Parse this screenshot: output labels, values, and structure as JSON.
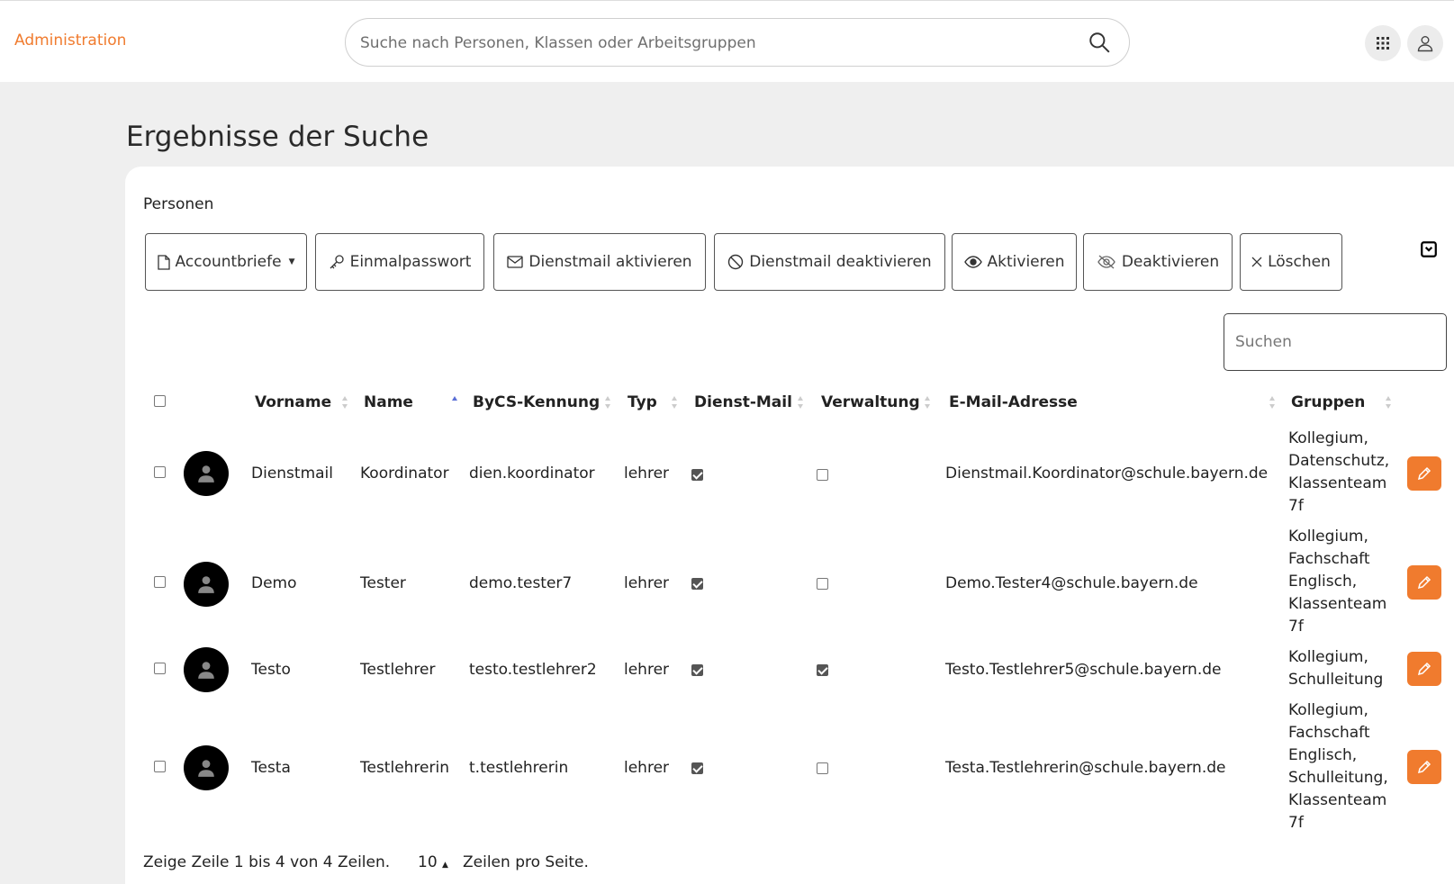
{
  "header": {
    "brand": "Administration",
    "search_placeholder": "Suche nach Personen, Klassen oder Arbeitsgruppen"
  },
  "page_title": "Ergebnisse der Suche",
  "section_label": "Personen",
  "toolbar": {
    "accountbriefe": "Accountbriefe",
    "einmalpasswort": "Einmalpasswort",
    "dienstmail_aktivieren": "Dienstmail aktivieren",
    "dienstmail_deaktivieren": "Dienstmail deaktivieren",
    "aktivieren": "Aktivieren",
    "deaktivieren": "Deaktivieren",
    "loeschen": "Löschen"
  },
  "table_search_placeholder": "Suchen",
  "columns": {
    "vorname": "Vorname",
    "name": "Name",
    "kennung": "ByCS-Kennung",
    "typ": "Typ",
    "dienstmail": "Dienst-Mail",
    "verwaltung": "Verwaltung",
    "email": "E-Mail-Adresse",
    "gruppen": "Gruppen"
  },
  "rows": [
    {
      "vorname": "Dienstmail",
      "name": "Koordinator",
      "kennung": "dien.koordinator",
      "typ": "lehrer",
      "dienstmail": true,
      "verwaltung": false,
      "email": "Dienstmail.Koordinator@schule.bayern.de",
      "gruppen": "Kollegium, Datenschutz, Klassenteam 7f"
    },
    {
      "vorname": "Demo",
      "name": "Tester",
      "kennung": "demo.tester7",
      "typ": "lehrer",
      "dienstmail": true,
      "verwaltung": false,
      "email": "Demo.Tester4@schule.bayern.de",
      "gruppen": "Kollegium, Fachschaft Englisch, Klassenteam 7f"
    },
    {
      "vorname": "Testo",
      "name": "Testlehrer",
      "kennung": "testo.testlehrer2",
      "typ": "lehrer",
      "dienstmail": true,
      "verwaltung": true,
      "email": "Testo.Testlehrer5@schule.bayern.de",
      "gruppen": "Kollegium, Schulleitung"
    },
    {
      "vorname": "Testa",
      "name": "Testlehrerin",
      "kennung": "t.testlehrerin",
      "typ": "lehrer",
      "dienstmail": true,
      "verwaltung": false,
      "email": "Testa.Testlehrerin@schule.bayern.de",
      "gruppen": "Kollegium, Fachschaft Englisch, Schulleitung, Klassenteam 7f"
    }
  ],
  "footer": {
    "summary": "Zeige Zeile 1 bis 4 von 4 Zeilen.",
    "page_size": "10",
    "per_page": "Zeilen pro Seite."
  },
  "colors": {
    "accent": "#f07b2e",
    "background": "#efefef"
  }
}
